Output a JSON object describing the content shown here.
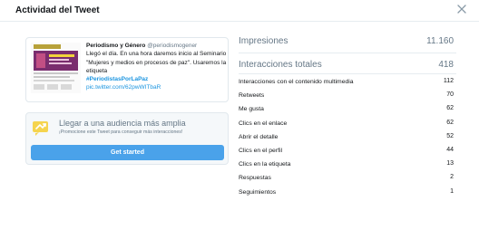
{
  "modal": {
    "title": "Actividad del Tweet"
  },
  "tweet": {
    "author": "Periodismo y Género",
    "handle": "@periodismogener",
    "text": "Llegó el día. En una hora daremos inicio al Seminario \"Mujeres y medios en procesos de paz\". Usaremos la etiqueta",
    "hashtag": "#PeriodistasPorLaPaz",
    "link": "pic.twitter.com/62pwWITbaR"
  },
  "promote": {
    "title": "Llegar a una audiencia más amplia",
    "subtitle": "¡Promocione este Tweet para conseguir más interacciones!",
    "button_label": "Get started"
  },
  "stats": {
    "impressions": {
      "label": "Impresiones",
      "value": "11.160"
    },
    "total_engagements": {
      "label": "Interacciones totales",
      "value": "418"
    },
    "rows": [
      {
        "label": "Interacciones con el contenido multimedia",
        "value": "112"
      },
      {
        "label": "Retweets",
        "value": "70"
      },
      {
        "label": "Me gusta",
        "value": "62"
      },
      {
        "label": "Clics en el enlace",
        "value": "62"
      },
      {
        "label": "Abrir el detalle",
        "value": "52"
      },
      {
        "label": "Clics en el perfil",
        "value": "44"
      },
      {
        "label": "Clics en la etiqueta",
        "value": "13"
      },
      {
        "label": "Respuestas",
        "value": "2"
      },
      {
        "label": "Seguimientos",
        "value": "1"
      }
    ]
  },
  "colors": {
    "link": "#1b95e0",
    "button": "#4aa2ea",
    "muted": "#657786"
  }
}
